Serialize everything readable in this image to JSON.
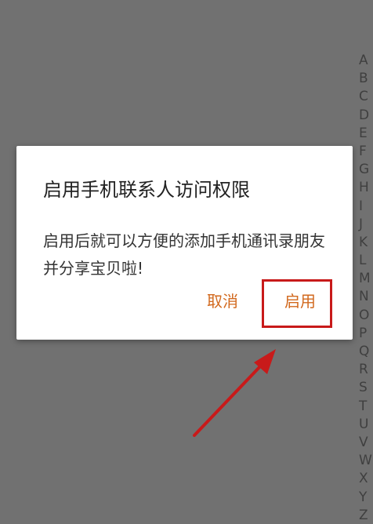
{
  "dialog": {
    "title": "启用手机联系人访问权限",
    "message": "启用后就可以方便的添加手机通讯录朋友并分享宝贝啦!",
    "cancel_label": "取消",
    "confirm_label": "启用"
  },
  "index_bar": {
    "letters": [
      "A",
      "B",
      "C",
      "D",
      "E",
      "F",
      "G",
      "H",
      "I",
      "J",
      "K",
      "L",
      "M",
      "N",
      "O",
      "P",
      "Q",
      "R",
      "S",
      "T",
      "U",
      "V",
      "W",
      "X",
      "Y",
      "Z"
    ]
  },
  "colors": {
    "accent": "#d2691e",
    "overlay": "#717171",
    "annotation": "#c81a1a"
  }
}
